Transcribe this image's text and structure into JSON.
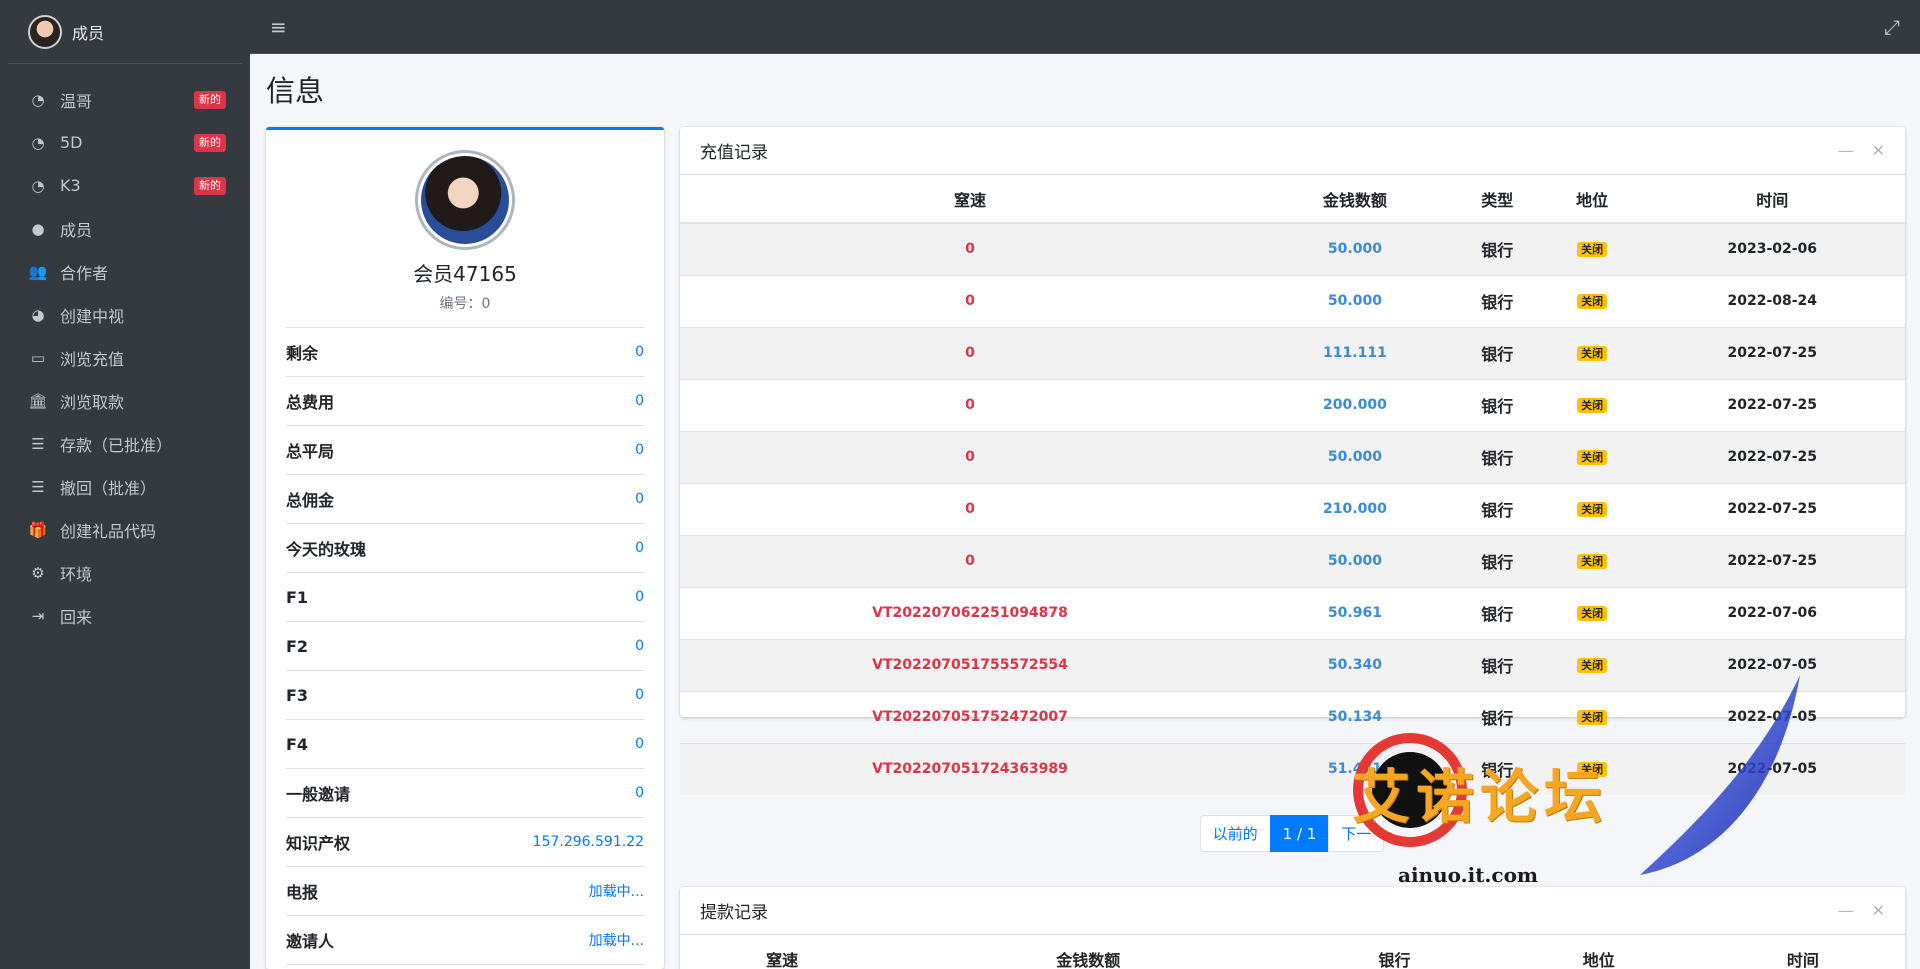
{
  "sidebar": {
    "brand": "成员",
    "items": [
      {
        "icon": "gauge-icon",
        "glyph": "◔",
        "label": "温哥",
        "badge": "新的"
      },
      {
        "icon": "gauge-icon",
        "glyph": "◔",
        "label": "5D",
        "badge": "新的"
      },
      {
        "icon": "gauge-icon",
        "glyph": "◔",
        "label": "K3",
        "badge": "新的"
      },
      {
        "icon": "user-circle-icon",
        "glyph": "●",
        "label": "成员",
        "badge": ""
      },
      {
        "icon": "users-icon",
        "glyph": "👥",
        "label": "合作者",
        "badge": ""
      },
      {
        "icon": "pie-chart-icon",
        "glyph": "◕",
        "label": "创建中视",
        "badge": ""
      },
      {
        "icon": "credit-card-icon",
        "glyph": "▭",
        "label": "浏览充值",
        "badge": ""
      },
      {
        "icon": "bank-icon",
        "glyph": "🏛",
        "label": "浏览取款",
        "badge": ""
      },
      {
        "icon": "list-icon",
        "glyph": "☰",
        "label": "存款（已批准）",
        "badge": ""
      },
      {
        "icon": "list-icon",
        "glyph": "☰",
        "label": "撤回（批准）",
        "badge": ""
      },
      {
        "icon": "gift-icon",
        "glyph": "🎁",
        "label": "创建礼品代码",
        "badge": ""
      },
      {
        "icon": "gear-icon",
        "glyph": "⚙",
        "label": "环境",
        "badge": ""
      },
      {
        "icon": "logout-icon",
        "glyph": "⇥",
        "label": "回来",
        "badge": ""
      }
    ]
  },
  "topbar": {
    "menu_glyph": "≡",
    "expand_glyph": "⤢"
  },
  "page_title": "信息",
  "profile": {
    "name": "会员47165",
    "id_text": "编号：0",
    "stats": [
      {
        "k": "剩余",
        "v": "0"
      },
      {
        "k": "总费用",
        "v": "0"
      },
      {
        "k": "总平局",
        "v": "0"
      },
      {
        "k": "总佣金",
        "v": "0"
      },
      {
        "k": "今天的玫瑰",
        "v": "0"
      },
      {
        "k": "F1",
        "v": "0"
      },
      {
        "k": "F2",
        "v": "0"
      },
      {
        "k": "F3",
        "v": "0"
      },
      {
        "k": "F4",
        "v": "0"
      },
      {
        "k": "一般邀请",
        "v": "0"
      },
      {
        "k": "知识产权",
        "v": "157.296.591.22"
      },
      {
        "k": "电报",
        "v": "加载中..."
      },
      {
        "k": "邀请人",
        "v": "加载中..."
      }
    ]
  },
  "recharge": {
    "title": "充值记录",
    "columns": [
      "窒速",
      "金钱数额",
      "类型",
      "地位",
      "时间"
    ],
    "rows": [
      [
        "0",
        "50.000",
        "银行",
        "关闭",
        "2023-02-06"
      ],
      [
        "0",
        "50.000",
        "银行",
        "关闭",
        "2022-08-24"
      ],
      [
        "0",
        "111.111",
        "银行",
        "关闭",
        "2022-07-25"
      ],
      [
        "0",
        "200.000",
        "银行",
        "关闭",
        "2022-07-25"
      ],
      [
        "0",
        "50.000",
        "银行",
        "关闭",
        "2022-07-25"
      ],
      [
        "0",
        "210.000",
        "银行",
        "关闭",
        "2022-07-25"
      ],
      [
        "0",
        "50.000",
        "银行",
        "关闭",
        "2022-07-25"
      ],
      [
        "VT202207062251094878",
        "50.961",
        "银行",
        "关闭",
        "2022-07-06"
      ],
      [
        "VT202207051755572554",
        "50.340",
        "银行",
        "关闭",
        "2022-07-05"
      ],
      [
        "VT202207051752472007",
        "50.134",
        "银行",
        "关闭",
        "2022-07-05"
      ],
      [
        "VT202207051724363989",
        "51.471",
        "银行",
        "关闭",
        "2022-07-05"
      ]
    ],
    "pagination": {
      "prev": "以前的",
      "current": "1 / 1",
      "next": "下一"
    }
  },
  "withdraw": {
    "title": "提款记录",
    "columns": [
      "窒速",
      "金钱数额",
      "银行",
      "地位",
      "时间"
    ]
  },
  "watermark": {
    "text": "艾诺论坛",
    "sub": "ainuo.it.com"
  }
}
